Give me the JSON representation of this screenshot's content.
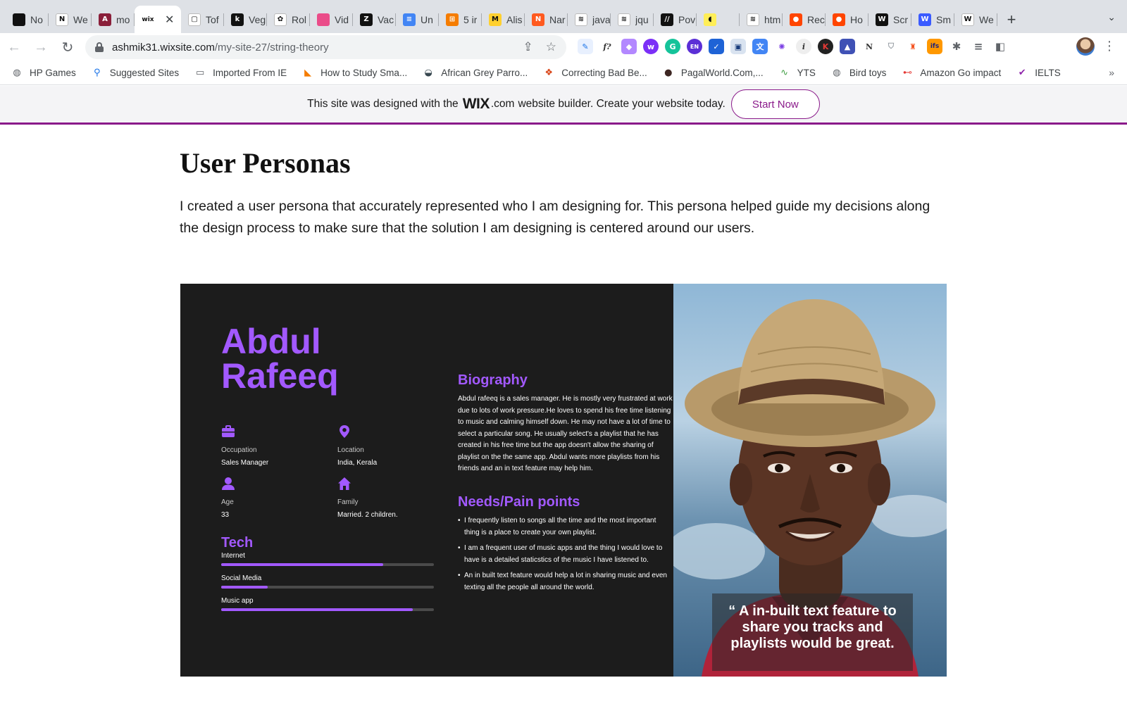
{
  "browser": {
    "tabs": [
      {
        "title": "No",
        "icon": "notion-black-icon",
        "color": "#111111",
        "glyph": ""
      },
      {
        "title": "We",
        "icon": "notion-icon",
        "color": "#ffffff",
        "glyph": "N"
      },
      {
        "title": "mo",
        "icon": "anchor-icon",
        "color": "#8a1f3a",
        "glyph": "A"
      },
      {
        "title": "WIX",
        "icon": "wix-icon",
        "color": "#ffffff",
        "glyph": "wix",
        "active": true
      },
      {
        "title": "Tof",
        "icon": "book-icon",
        "color": "#ffffff",
        "glyph": "▢"
      },
      {
        "title": "Veg",
        "icon": "k-icon",
        "color": "#111111",
        "glyph": "k"
      },
      {
        "title": "Rol",
        "icon": "openai-icon",
        "color": "#ffffff",
        "glyph": "✿"
      },
      {
        "title": "Vid",
        "icon": "dribbble-icon",
        "color": "#ea4c89",
        "glyph": ""
      },
      {
        "title": "Vac",
        "icon": "z-icon",
        "color": "#111111",
        "glyph": "Z"
      },
      {
        "title": "Un",
        "icon": "docs-icon",
        "color": "#4285f4",
        "glyph": "≡"
      },
      {
        "title": "5 ir",
        "icon": "grid-icon",
        "color": "#f57c00",
        "glyph": "⊞"
      },
      {
        "title": "Alis",
        "icon": "miro-icon",
        "color": "#ffd02f",
        "glyph": "M"
      },
      {
        "title": "Nar",
        "icon": "n-icon",
        "color": "#ff5a1f",
        "glyph": "N"
      },
      {
        "title": "java",
        "icon": "stackoverflow-icon",
        "color": "#ffffff",
        "glyph": "≋"
      },
      {
        "title": "jqu",
        "icon": "stackoverflow-icon",
        "color": "#ffffff",
        "glyph": "≋"
      },
      {
        "title": "Pov",
        "icon": "medium-icon",
        "color": "#111111",
        "glyph": "//"
      },
      {
        "title": "",
        "icon": "speaker-icon",
        "color": "#ffee58",
        "glyph": "◖"
      },
      {
        "title": "htm",
        "icon": "stackoverflow-icon",
        "color": "#ffffff",
        "glyph": "≋"
      },
      {
        "title": "Rec",
        "icon": "reddit-icon",
        "color": "#ff4500",
        "glyph": "●"
      },
      {
        "title": "Ho",
        "icon": "reddit-icon",
        "color": "#ff4500",
        "glyph": "●"
      },
      {
        "title": "Scr",
        "icon": "w-icon",
        "color": "#111111",
        "glyph": "W"
      },
      {
        "title": "Sm",
        "icon": "w-blue-icon",
        "color": "#3b5bff",
        "glyph": "W"
      },
      {
        "title": "We",
        "icon": "w-outline-icon",
        "color": "#ffffff",
        "glyph": "W"
      }
    ],
    "url_host": "ashmik31.wixsite.com",
    "url_path": "/my-site-27/string-theory",
    "bookmarks": [
      {
        "label": "HP Games",
        "icon": "globe-icon"
      },
      {
        "label": "Suggested Sites",
        "icon": "search-icon"
      },
      {
        "label": "Imported From IE",
        "icon": "folder-icon"
      },
      {
        "label": "How to Study Sma...",
        "icon": "bookmark-logo-icon"
      },
      {
        "label": "African Grey Parro...",
        "icon": "parrot-icon"
      },
      {
        "label": "Correcting Bad Be...",
        "icon": "paw-icon"
      },
      {
        "label": "PagalWorld.Com,...",
        "icon": "face-icon"
      },
      {
        "label": "YTS",
        "icon": "yts-icon"
      },
      {
        "label": "Bird toys",
        "icon": "globe-icon"
      },
      {
        "label": "Amazon Go impact",
        "icon": "amazon-icon"
      },
      {
        "label": "IELTS",
        "icon": "ielts-icon"
      }
    ]
  },
  "wix_banner": {
    "text_before": "This site was designed with the",
    "logo": "WIX",
    "logo_suffix": ".com",
    "text_after": "website builder. Create your website today.",
    "button": "Start Now"
  },
  "page": {
    "title": "User Personas",
    "description": "I created a user persona that accurately represented who I am designing for. This persona helped guide my decisions along the design process to make sure that the solution I am designing is centered around our users."
  },
  "persona": {
    "name_line1": "Abdul",
    "name_line2": "Rafeeq",
    "facts": {
      "occupation": {
        "label": "Occupation",
        "value": "Sales Manager"
      },
      "location": {
        "label": "Location",
        "value": "India, Kerala"
      },
      "age": {
        "label": "Age",
        "value": "33"
      },
      "family": {
        "label": "Family",
        "value": "Married. 2 children."
      }
    },
    "tech_title": "Tech",
    "tech": [
      {
        "label": "Internet",
        "level": 0.76
      },
      {
        "label": "Social Media",
        "level": 0.22
      },
      {
        "label": "Music app",
        "level": 0.9
      }
    ],
    "biography_title": "Biography",
    "biography": "Abdul rafeeq is a sales manager. He is mostly very frustrated at work due to lots of work pressure.He loves to spend his free time listening to music and calming himself down. He may not have a lot of time to select a particular song. He usually select's a playlist that he has created in his free time but the app doesn't allow the sharing of playlist on the the same app. Abdul wants more playlists from his friends and an in text feature may help him.",
    "needs_title": "Needs/Pain points",
    "needs": [
      "I frequently listen to songs all the time and the most important thing is a place to create your own playlist.",
      "I am a frequent user of music apps and the thing I would love to have is a detailed staticstics of the music I have listened to.",
      "An in built text feature would help a lot in sharing music and even texting all the people all around the world."
    ],
    "quote": "“ A in-built text feature to share you tracks and playlists would be great.",
    "accent_color": "#a259ff"
  }
}
